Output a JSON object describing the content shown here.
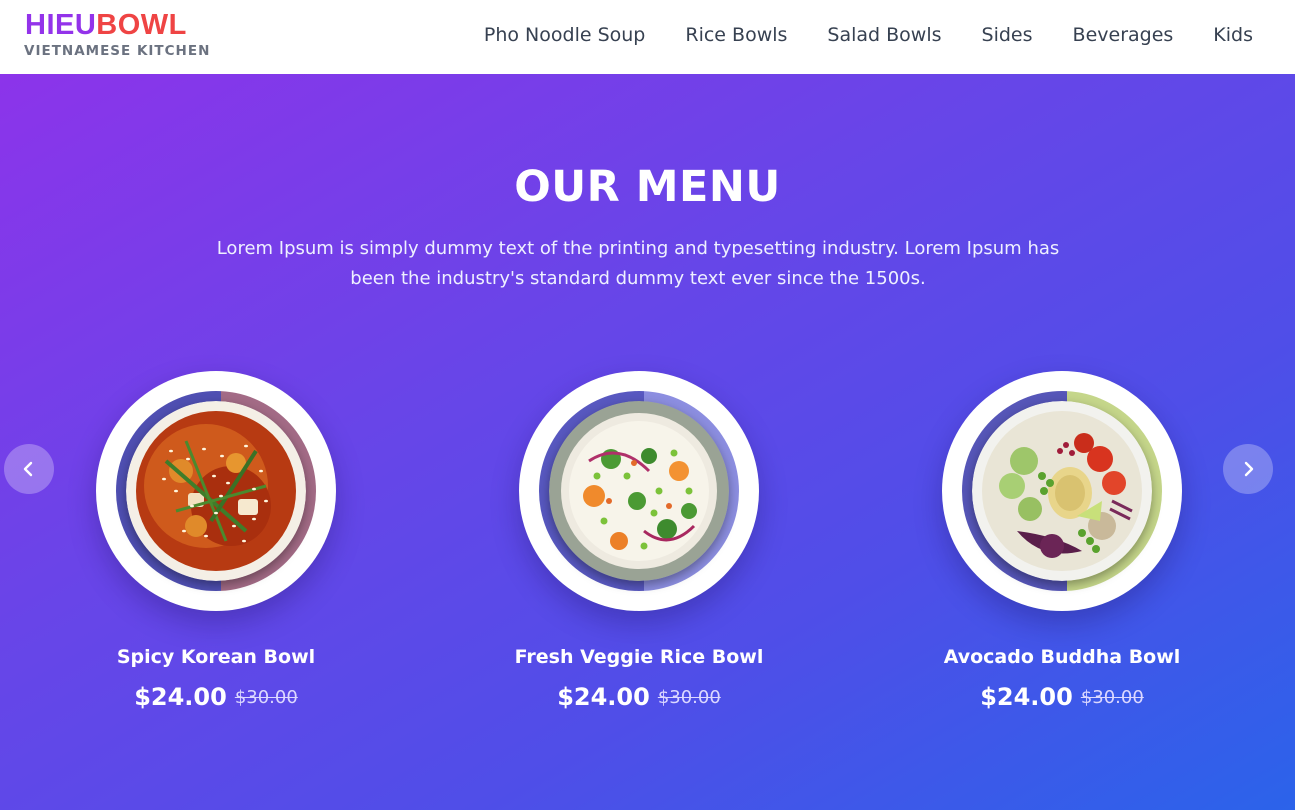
{
  "brand": {
    "name_part1": "HIEU",
    "name_part2": "BOWL",
    "tagline": "VIETNAMESE KITCHEN",
    "color_part1": "#9333ea",
    "color_part2": "#ef4444"
  },
  "nav": {
    "items": [
      {
        "label": "Pho Noodle Soup"
      },
      {
        "label": "Rice Bowls"
      },
      {
        "label": "Salad Bowls"
      },
      {
        "label": "Sides"
      },
      {
        "label": "Beverages"
      },
      {
        "label": "Kids"
      }
    ]
  },
  "hero": {
    "title": "OUR MENU",
    "description": "Lorem Ipsum is simply dummy text of the printing and typesetting industry. Lorem Ipsum has been the industry's standard dummy text ever since the 1500s.",
    "gradient_colors": [
      "#8c34ea",
      "#4f4ee8",
      "#2b63ea"
    ]
  },
  "menu": {
    "items": [
      {
        "name": "Spicy Korean Bowl",
        "price": "$24.00",
        "old_price": "$30.00",
        "image_icon": "spicy-soup-bowl-image",
        "accent": "#a36b86"
      },
      {
        "name": "Fresh Veggie Rice Bowl",
        "price": "$24.00",
        "old_price": "$30.00",
        "image_icon": "veggie-rice-bowl-image",
        "accent": "#8c8ee0"
      },
      {
        "name": "Avocado Buddha Bowl",
        "price": "$24.00",
        "old_price": "$30.00",
        "image_icon": "buddha-bowl-image",
        "accent": "#c5d68a"
      }
    ]
  },
  "carousel": {
    "prev_icon": "chevron-left-icon",
    "next_icon": "chevron-right-icon"
  }
}
